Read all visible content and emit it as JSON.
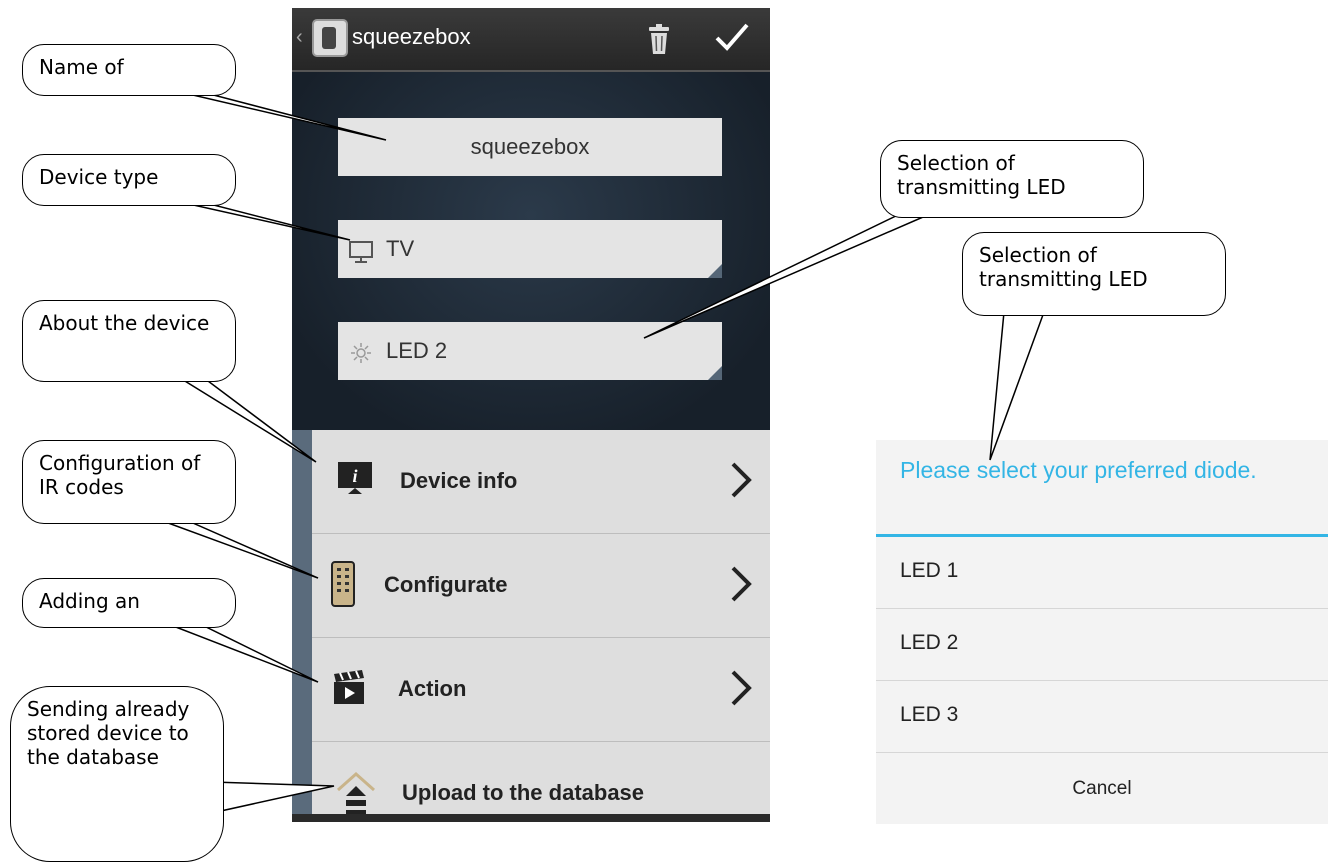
{
  "callouts": {
    "name": "Name of",
    "device_type": "Device type",
    "about": "About the device",
    "config": "Configuration of IR codes",
    "adding": "Adding an",
    "sending": "Sending already stored device to the database",
    "led_sel_1": "Selection of transmitting LED",
    "led_sel_2": "Selection of transmitting LED"
  },
  "phone": {
    "app_title": "squeezebox",
    "name_value": "squeezebox",
    "type_value": "TV",
    "led_value": "LED 2",
    "rows": [
      {
        "label": "Device info",
        "icon": "info-screen-icon"
      },
      {
        "label": "Configurate",
        "icon": "remote-icon"
      },
      {
        "label": "Action",
        "icon": "clapperboard-icon"
      },
      {
        "label": "Upload to the database",
        "icon": "upload-house-icon"
      }
    ]
  },
  "dialog": {
    "title": "Please select your preferred diode.",
    "options": [
      "LED 1",
      "LED 2",
      "LED 3"
    ],
    "cancel": "Cancel"
  },
  "colors": {
    "accent": "#33b5e5",
    "list_bg": "#dedede",
    "field_bg": "#e4e4e4"
  }
}
